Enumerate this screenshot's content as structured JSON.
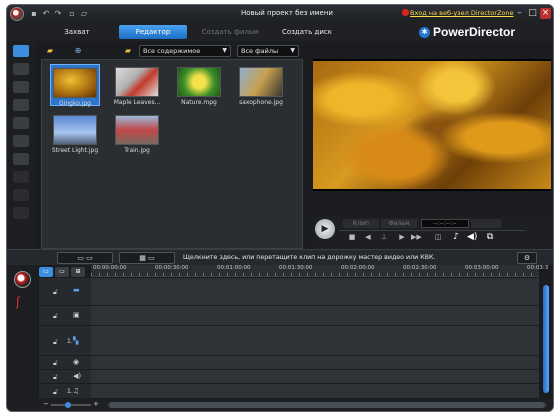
{
  "window": {
    "title": "Новый проект без имени"
  },
  "titlebar": {
    "directorzone_link": "Вход на веб-узел DirectorZone"
  },
  "brand": {
    "name": "PowerDirector"
  },
  "tabs": [
    {
      "label": "Захват",
      "state": "normal"
    },
    {
      "label": "Редактор",
      "state": "active"
    },
    {
      "label": "Создать фильм",
      "state": "disabled"
    },
    {
      "label": "Создать диск",
      "state": "normal"
    }
  ],
  "library": {
    "filter_content": "Все содержимое",
    "filter_files": "Все файлы",
    "items": [
      {
        "label": "Gingko.jpg",
        "selected": true,
        "icon": "ginkgo-photo"
      },
      {
        "label": "Maple Leaves...",
        "selected": false,
        "icon": "maple-photo"
      },
      {
        "label": "Nature.mpg",
        "selected": false,
        "icon": "nature-video"
      },
      {
        "label": "saxophone.jpg",
        "selected": false,
        "icon": "saxophone-photo"
      },
      {
        "label": "Street Light.jpg",
        "selected": false,
        "icon": "street-light-photo"
      },
      {
        "label": "Train.jpg",
        "selected": false,
        "icon": "train-photo"
      }
    ]
  },
  "preview": {
    "mode_clip": "Клип",
    "mode_film": "Фильм",
    "timecode": "--:--:--:--"
  },
  "timeline": {
    "hint": "Щелкните здесь, или перетащите клип на дорожку мастер видео или КВК.",
    "ticks": [
      "00:00:00:00",
      "00:00:30:00",
      "00:01:00:00",
      "00:01:30:00",
      "00:02:00:00",
      "00:02:30:00",
      "00:03:00:00",
      "00:03:3"
    ],
    "tracks": [
      {
        "num": "",
        "icon": "video-track-icon"
      },
      {
        "num": "",
        "icon": "fx-track-icon"
      },
      {
        "num": "1.",
        "icon": "pip-track-icon"
      },
      {
        "num": "",
        "icon": "title-track-icon"
      },
      {
        "num": "",
        "icon": "voice-track-icon"
      },
      {
        "num": "1.",
        "icon": "music-track-icon"
      }
    ]
  },
  "colors": {
    "accent": "#3d8de0",
    "link": "#ffd94a"
  }
}
